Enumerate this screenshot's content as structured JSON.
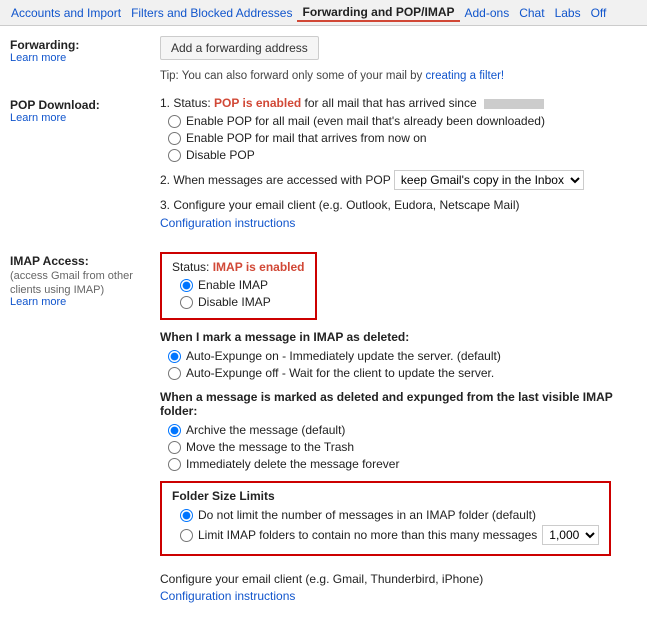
{
  "nav": {
    "tabs": [
      {
        "label": "Accounts and Import",
        "active": false
      },
      {
        "label": "Filters and Blocked Addresses",
        "active": false
      },
      {
        "label": "Forwarding and POP/IMAP",
        "active": true
      },
      {
        "label": "Add-ons",
        "active": false
      },
      {
        "label": "Chat",
        "active": false
      },
      {
        "label": "Labs",
        "active": false
      },
      {
        "label": "Off",
        "active": false
      }
    ]
  },
  "forwarding": {
    "label": "Forwarding:",
    "learn_more": "Learn more",
    "add_btn": "Add a forwarding address",
    "tip": "Tip: You can also forward only some of your mail by",
    "tip_link": "creating a filter!",
    "step1_label": "1. Status:",
    "step1_status": "POP is enabled",
    "step1_status_suffix": "for all mail that has arrived since",
    "option1": "Enable POP for all mail (even mail that's already been downloaded)",
    "option2": "Enable POP for mail that arrives from now on",
    "option3": "Disable POP",
    "step2_label": "2. When messages are accessed with POP",
    "step2_select_option": "keep Gmail's copy in the Inbox",
    "step3_label": "3. Configure your email client (e.g. Outlook, Eudora, Netscape Mail)",
    "config_link": "Configuration instructions"
  },
  "imap": {
    "label": "IMAP Access:",
    "sublabel": "(access Gmail from other clients using IMAP)",
    "learn_more": "Learn more",
    "status_label": "Status:",
    "status_text": "IMAP is enabled",
    "enable_label": "Enable IMAP",
    "disable_label": "Disable IMAP",
    "deleted_title": "When I mark a message in IMAP as deleted:",
    "deleted_opt1": "Auto-Expunge on - Immediately update the server. (default)",
    "deleted_opt2": "Auto-Expunge off - Wait for the client to update the server.",
    "expunged_title": "When a message is marked as deleted and expunged from the last visible IMAP folder:",
    "expunged_opt1": "Archive the message (default)",
    "expunged_opt2": "Move the message to the Trash",
    "expunged_opt3": "Immediately delete the message forever",
    "folder_title": "Folder Size Limits",
    "folder_opt1": "Do not limit the number of messages in an IMAP folder (default)",
    "folder_opt2": "Limit IMAP folders to contain no more than this many messages",
    "folder_select": "1,000",
    "configure_title": "Configure your email client (e.g. Gmail, Thunderbird, iPhone)",
    "configure_link": "Configuration instructions"
  }
}
